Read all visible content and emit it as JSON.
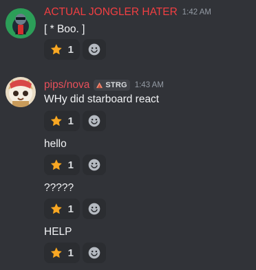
{
  "colors": {
    "background": "#313338",
    "username_red": "#f23f42",
    "username_pips": "#e8505b",
    "reaction_bg": "#2b2d31",
    "star": "#f9a825"
  },
  "messages": [
    {
      "username": "ACTUAL JONGLER HATER",
      "timestamp": "1:42 AM",
      "lines": [
        {
          "text": "[ * Boo. ]",
          "reaction_emoji": "star-emoji",
          "reaction_count": "1"
        }
      ]
    },
    {
      "username": "pips/nova",
      "tag": "STRG",
      "tag_icon": "tent-icon",
      "timestamp": "1:43 AM",
      "lines": [
        {
          "text": "WHy did starboard react",
          "reaction_emoji": "star-emoji",
          "reaction_count": "1"
        },
        {
          "text": "hello",
          "reaction_emoji": "star-emoji",
          "reaction_count": "1"
        },
        {
          "text": "?????",
          "reaction_emoji": "star-emoji",
          "reaction_count": "1"
        },
        {
          "text": "HELP",
          "reaction_emoji": "star-emoji",
          "reaction_count": "1"
        }
      ]
    }
  ]
}
